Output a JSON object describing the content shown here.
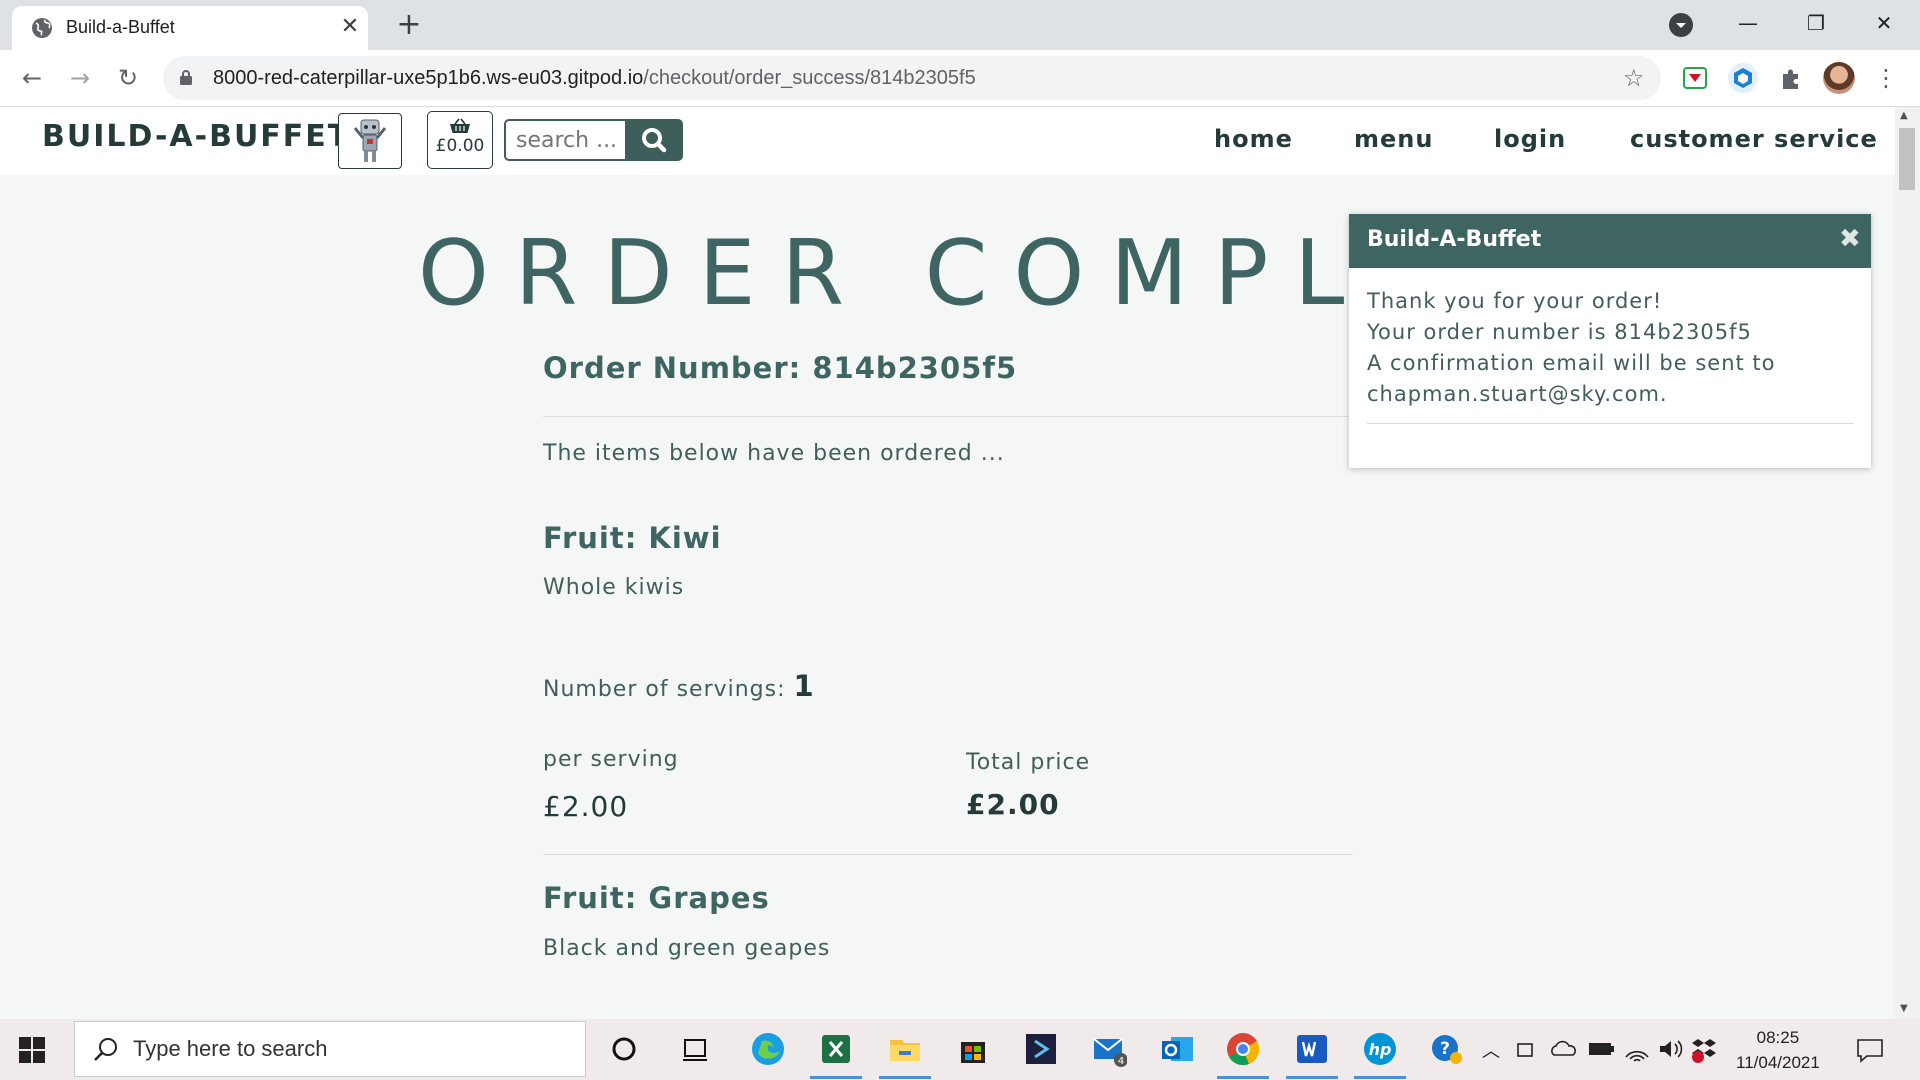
{
  "browser": {
    "tab_title": "Build-a-Buffet",
    "tab_close": "✕",
    "new_tab": "+",
    "url_host": "8000-red-caterpillar-uxe5p1b6.ws-eu03.gitpod.io",
    "url_path": "/checkout/order_success/814b2305f5",
    "back": "←",
    "forward": "→",
    "reload": "↻",
    "star": "☆",
    "minimize": "—",
    "restore": "❐",
    "close": "✕"
  },
  "header": {
    "brand": "BUILD-A-BUFFET",
    "basket_total": "£0.00",
    "search_placeholder": "search ...",
    "nav": [
      "home",
      "menu",
      "login",
      "customer service"
    ]
  },
  "page": {
    "title": "ORDER COMPLETE",
    "order_number": "Order Number: 814b2305f5",
    "intro": "The items below have been ordered ...",
    "items": [
      {
        "name": "Fruit: Kiwi",
        "description": "Whole kiwis",
        "servings_label": "Number of servings:",
        "servings": "1",
        "per_serving_label": "per serving",
        "per_serving": "£2.00",
        "total_label": "Total price",
        "total": "£2.00"
      },
      {
        "name": "Fruit: Grapes",
        "description": "Black and green geapes"
      }
    ]
  },
  "toast": {
    "title": "Build-A-Buffet",
    "close": "✖",
    "line1": "Thank you for your order!",
    "line2": "Your order number is 814b2305f5",
    "line3": "A confirmation email will be sent to",
    "line4": "chapman.stuart@sky.com."
  },
  "taskbar": {
    "search_placeholder": "Type here to search",
    "time": "08:25",
    "date": "11/04/2021",
    "mail_badge": "4"
  }
}
